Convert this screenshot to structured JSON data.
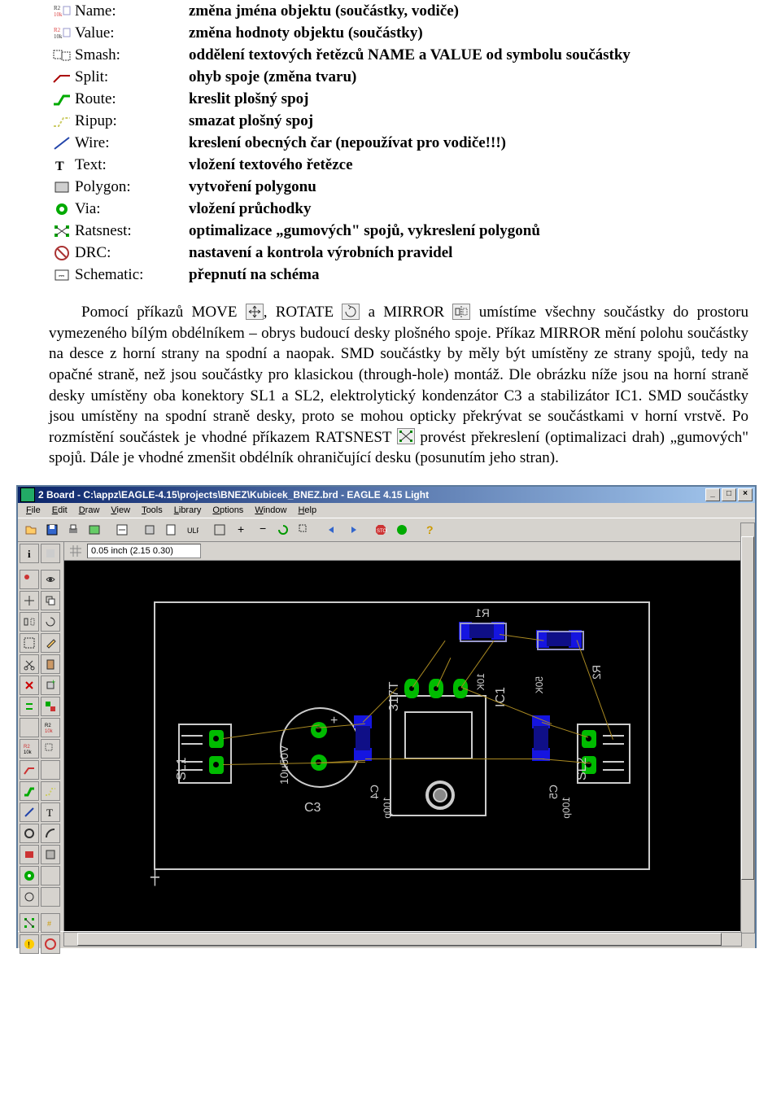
{
  "commands": [
    {
      "label": "Name:",
      "desc": "změna jména objektu (součástky, vodiče)"
    },
    {
      "label": "Value:",
      "desc": "změna hodnoty objektu (součástky)"
    },
    {
      "label": "Smash:",
      "desc": "oddělení textových řetězců NAME a VALUE od symbolu součástky"
    },
    {
      "label": "Split:",
      "desc": "ohyb spoje (změna tvaru)"
    },
    {
      "label": "Route:",
      "desc": "kreslit plošný spoj"
    },
    {
      "label": "Ripup:",
      "desc": "smazat plošný spoj"
    },
    {
      "label": "Wire:",
      "desc": "kreslení obecných čar (nepoužívat pro vodiče!!!)"
    },
    {
      "label": "Text:",
      "desc": "vložení textového řetězce"
    },
    {
      "label": "Polygon:",
      "desc": "vytvoření polygonu"
    },
    {
      "label": "Via:",
      "desc": "vložení průchodky"
    },
    {
      "label": "Ratsnest:",
      "desc": "optimalizace „gumových\" spojů, vykreslení polygonů"
    },
    {
      "label": "DRC:",
      "desc": "nastavení a kontrola výrobních pravidel"
    },
    {
      "label": "Schematic:",
      "desc": "přepnutí na schéma"
    }
  ],
  "para": {
    "p1a": "Pomocí příkazů MOVE ",
    "p1b": ", ROTATE ",
    "p1c": " a MIRROR ",
    "p1d": " umístíme všechny součástky do prostoru vymezeného bílým obdélníkem – obrys budoucí desky plošného spoje. Příkaz MIRROR mění polohu součástky na desce z horní strany na spodní a naopak. SMD součástky by měly být umístěny ze strany spojů, tedy na opačné straně, než jsou součástky pro klasickou (through-hole) montáž. Dle obrázku níže jsou na horní straně desky umístěny oba konektory SL1 a SL2, elektrolytický kondenzátor C3 a stabilizátor IC1. SMD součástky jsou umístěny na spodní straně desky, proto se mohou opticky překrývat se součástkami v horní vrstvě. Po rozmístění součástek je vhodné příkazem RATSNEST ",
    "p1e": " provést překreslení (optimalizaci drah) „gumových\" spojů. Dále je vhodné zmenšit obdélník ohraničující desku (posunutím jeho stran)."
  },
  "window": {
    "title": "2 Board - C:\\appz\\EAGLE-4.15\\projects\\BNEZ\\Kubicek_BNEZ.brd - EAGLE 4.15 Light",
    "coords": "0.05 inch (2.15 0.30)",
    "menu": [
      "File",
      "Edit",
      "Draw",
      "View",
      "Tools",
      "Library",
      "Options",
      "Window",
      "Help"
    ]
  },
  "parts": {
    "sl1": "SL1",
    "sl2": "SL2",
    "c3": "C3",
    "c3v": "10u50V",
    "c4": "C4",
    "c4v": "100p",
    "c5": "C5",
    "c5v": "100p",
    "r1": "R1",
    "r1v": "10K",
    "r2": "R2",
    "r2v": "50K",
    "ic1": "IC1",
    "ic1v": "317T"
  }
}
